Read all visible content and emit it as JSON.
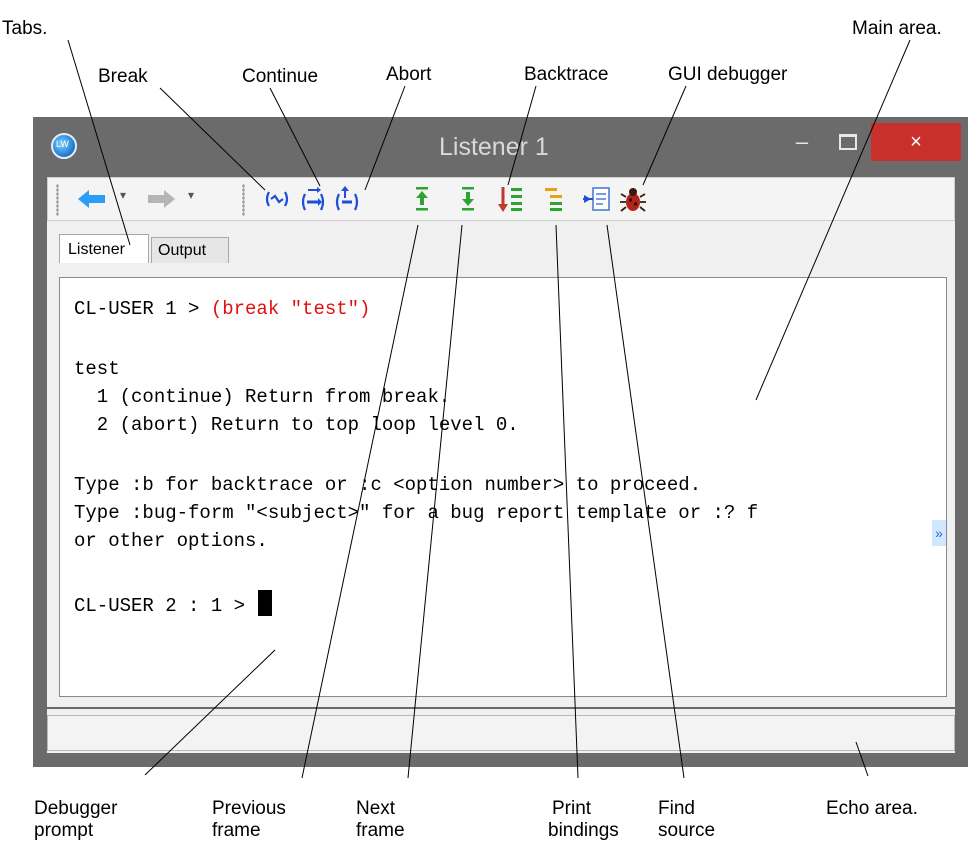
{
  "window": {
    "title": "Listener 1",
    "minimize_glyph": "–",
    "close_glyph": "×",
    "app_icon_text": "LW"
  },
  "toolbar": {
    "back_icon": "left-arrow-icon",
    "forward_icon": "right-arrow-icon",
    "dropdown_glyph": "▾",
    "items": [
      {
        "name": "break",
        "icon": "break-icon"
      },
      {
        "name": "continue",
        "icon": "continue-icon"
      },
      {
        "name": "abort",
        "icon": "abort-icon"
      },
      {
        "name": "previous-frame",
        "icon": "up-arrow-icon"
      },
      {
        "name": "next-frame",
        "icon": "down-arrow-icon"
      },
      {
        "name": "backtrace",
        "icon": "backtrace-icon"
      },
      {
        "name": "print-bindings",
        "icon": "bindings-icon"
      },
      {
        "name": "find-source",
        "icon": "find-source-icon"
      },
      {
        "name": "gui-debugger",
        "icon": "bug-icon"
      }
    ]
  },
  "tabs": [
    {
      "label": "Listener",
      "active": true
    },
    {
      "label": "Output",
      "active": false
    }
  ],
  "listener": {
    "prompt1": "CL-USER 1 > ",
    "command": "(break \"test\")",
    "lines": [
      "test",
      "  1 (continue) Return from break.",
      "  2 (abort) Return to top loop level 0.",
      "Type :b for backtrace or :c <option number> to proceed.",
      "Type :bug-form \"<subject>\" for a bug report template or :? f",
      "or other options."
    ],
    "prompt2": "CL-USER 2 : 1 > ",
    "more_glyph": "»"
  },
  "annotations": {
    "tabs": "Tabs.",
    "break": "Break",
    "continue": "Continue",
    "abort": "Abort",
    "backtrace": "Backtrace",
    "gui_debugger": "GUI debugger",
    "main_area": "Main area.",
    "debugger_prompt": [
      "Debugger",
      "prompt"
    ],
    "previous_frame": [
      "Previous",
      "frame"
    ],
    "next_frame": [
      "Next",
      "frame"
    ],
    "print_bindings": [
      "Print",
      "bindings"
    ],
    "find_source": [
      "Find",
      "source"
    ],
    "echo_area": "Echo area."
  },
  "colors": {
    "close_button": "#c9302c",
    "command_text": "#e01010",
    "blue_icons": "#1f4fd6",
    "green_icons": "#2fa32f",
    "orange_icons": "#e8a21a"
  }
}
